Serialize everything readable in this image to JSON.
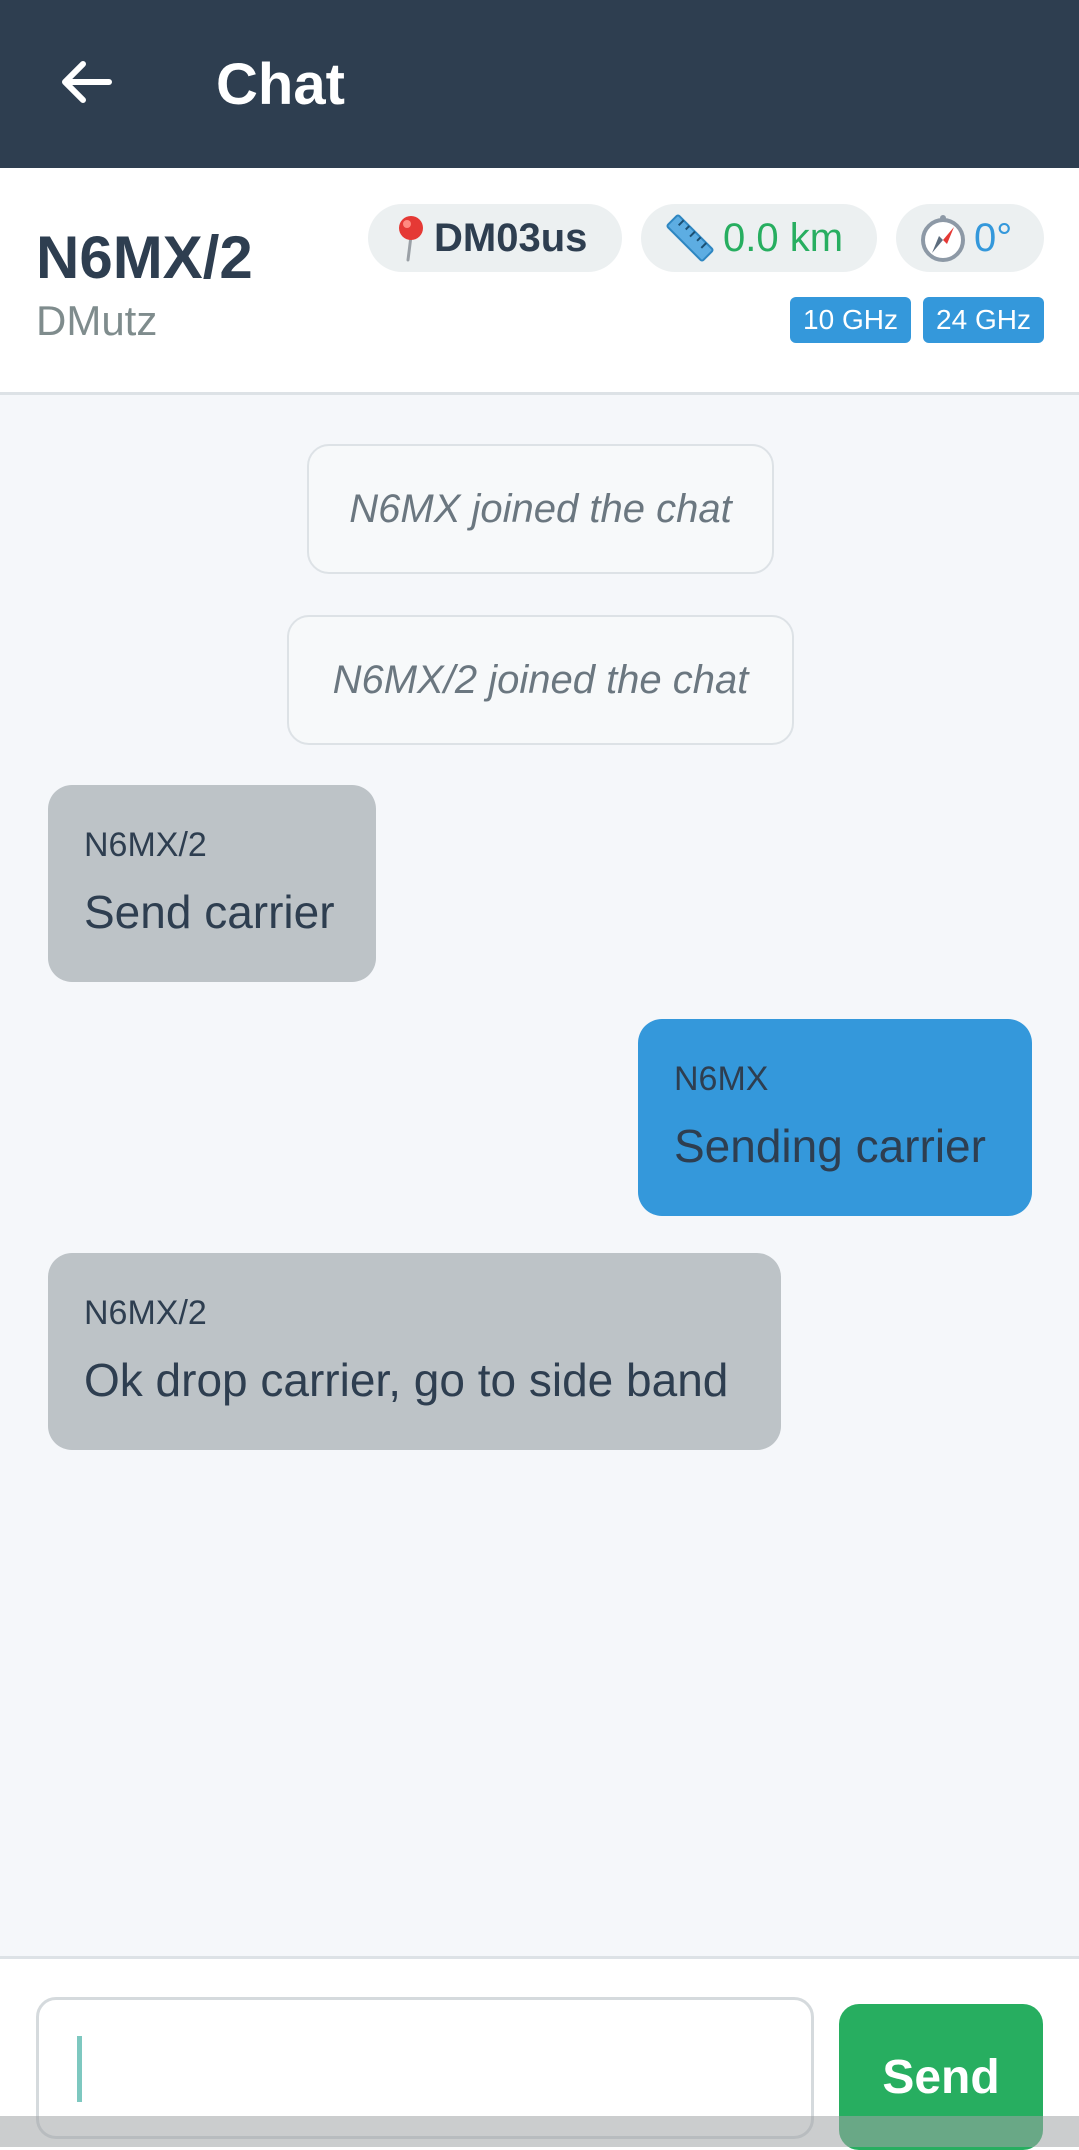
{
  "appbar": {
    "title": "Chat",
    "back_icon": "arrow-left-icon",
    "background": "#2e3e50"
  },
  "station": {
    "callsign": "N6MX/2",
    "grid": "DMutz",
    "locator": {
      "icon": "round-pushpin-icon",
      "value": "DM03us"
    },
    "distance": {
      "icon": "ruler-icon",
      "value": "0.0 km",
      "color": "#27ae60"
    },
    "bearing": {
      "icon": "compass-icon",
      "value": "0°",
      "color": "#3498db"
    },
    "bands": [
      "10 GHz",
      "24 GHz"
    ]
  },
  "system_messages": [
    "N6MX joined the chat",
    "N6MX/2 joined the chat"
  ],
  "messages": [
    {
      "sender": "N6MX/2",
      "text": "Send carrier",
      "direction": "incoming"
    },
    {
      "sender": "N6MX",
      "text": "Sending carrier",
      "direction": "outgoing"
    },
    {
      "sender": "N6MX/2",
      "text": "Ok drop carrier, go to side band",
      "direction": "incoming"
    }
  ],
  "composer": {
    "value": "",
    "send_label": "Send",
    "send_color": "#27ae60"
  },
  "colors": {
    "accent": "#3498db",
    "incoming_bubble": "#bdc3c7",
    "outgoing_bubble": "#3498db"
  }
}
